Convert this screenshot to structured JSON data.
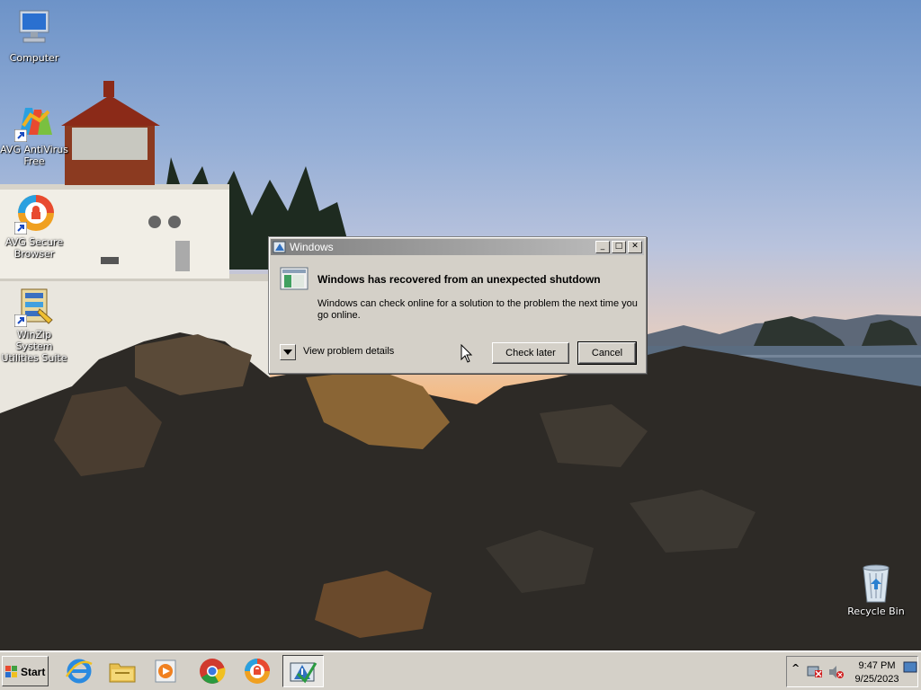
{
  "desktop": {
    "icons": [
      {
        "label": "Computer"
      },
      {
        "label": "AVG AntiVirus Free"
      },
      {
        "label": "AVG Secure Browser"
      },
      {
        "label": "WinZip System Utilities Suite"
      },
      {
        "label": "Recycle Bin"
      }
    ]
  },
  "dialog": {
    "title": "Windows",
    "heading": "Windows has recovered from an unexpected shutdown",
    "body": "Windows can check online for a solution to the problem the next time you go online.",
    "details_label": "View problem details",
    "check_later_label": "Check later",
    "cancel_label": "Cancel",
    "minimize_glyph": "_",
    "maximize_glyph": "□",
    "close_glyph": "✕"
  },
  "taskbar": {
    "start_label": "Start",
    "apps": [
      {
        "icon": "internet-explorer-icon"
      },
      {
        "icon": "file-explorer-icon"
      },
      {
        "icon": "media-player-icon"
      },
      {
        "icon": "chrome-icon"
      },
      {
        "icon": "avg-secure-browser-icon"
      },
      {
        "icon": "action-center-icon"
      }
    ],
    "tray": {
      "expand_glyph": "^",
      "time": "9:47 PM",
      "date": "9/25/2023"
    }
  },
  "colors": {
    "dialog_bg": "#d4d0c8",
    "titlebar_start": "#808080",
    "titlebar_end": "#c0c0c0",
    "taskbar_bg": "#d4d0c8"
  }
}
